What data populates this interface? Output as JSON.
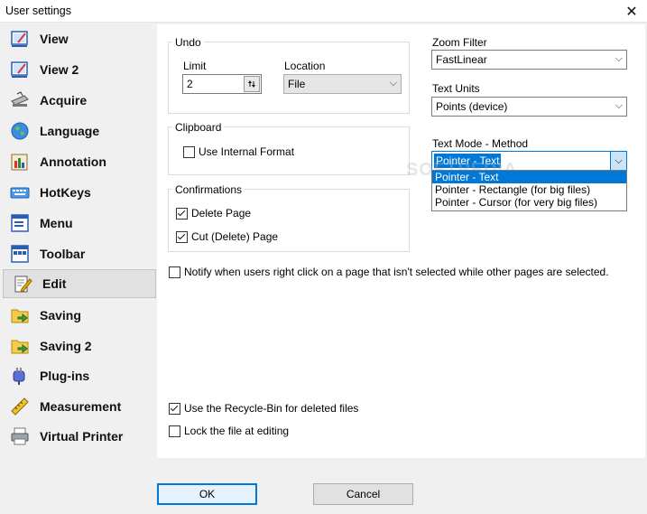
{
  "window": {
    "title": "User settings",
    "close_glyph": "✕"
  },
  "sidebar": {
    "items": [
      {
        "label": "View",
        "icon": "view-icon"
      },
      {
        "label": "View 2",
        "icon": "view2-icon"
      },
      {
        "label": "Acquire",
        "icon": "scanner-icon"
      },
      {
        "label": "Language",
        "icon": "globe-icon"
      },
      {
        "label": "Annotation",
        "icon": "annotation-icon"
      },
      {
        "label": "HotKeys",
        "icon": "keyboard-icon"
      },
      {
        "label": "Menu",
        "icon": "menu-icon"
      },
      {
        "label": "Toolbar",
        "icon": "toolbar-icon"
      },
      {
        "label": "Edit",
        "icon": "edit-icon",
        "selected": true
      },
      {
        "label": "Saving",
        "icon": "saving-icon"
      },
      {
        "label": "Saving 2",
        "icon": "saving2-icon"
      },
      {
        "label": "Plug-ins",
        "icon": "plugin-icon"
      },
      {
        "label": "Measurement",
        "icon": "ruler-icon"
      },
      {
        "label": "Virtual Printer",
        "icon": "printer-icon"
      }
    ]
  },
  "undo": {
    "title": "Undo",
    "limit_label": "Limit",
    "limit_value": "2",
    "location_label": "Location",
    "location_value": "File"
  },
  "clipboard": {
    "title": "Clipboard",
    "use_internal_label": "Use Internal Format",
    "use_internal_checked": false
  },
  "confirmations": {
    "title": "Confirmations",
    "delete_page_label": "Delete Page",
    "delete_page_checked": true,
    "cut_page_label": "Cut (Delete) Page",
    "cut_page_checked": true
  },
  "zoom_filter": {
    "label": "Zoom Filter",
    "value": "FastLinear"
  },
  "text_units": {
    "label": "Text Units",
    "value": "Points (device)"
  },
  "text_mode": {
    "label": "Text Mode - Method",
    "value": "Pointer - Text",
    "options": [
      "Pointer - Text",
      "Pointer - Rectangle (for big files)",
      "Pointer - Cursor (for very big files)"
    ],
    "highlighted_index": 0
  },
  "notify": {
    "label": "Notify when users right click on a page that isn't selected while other pages are selected.",
    "checked": false
  },
  "recycle_bin": {
    "label": "Use the Recycle-Bin for deleted files",
    "checked": true
  },
  "lock_file": {
    "label": "Lock the file at editing",
    "checked": false
  },
  "buttons": {
    "ok": "OK",
    "cancel": "Cancel"
  },
  "watermark": "SOFTPEDIA",
  "colors": {
    "accent": "#0078d7",
    "selected_bg": "#e1e1e1"
  }
}
